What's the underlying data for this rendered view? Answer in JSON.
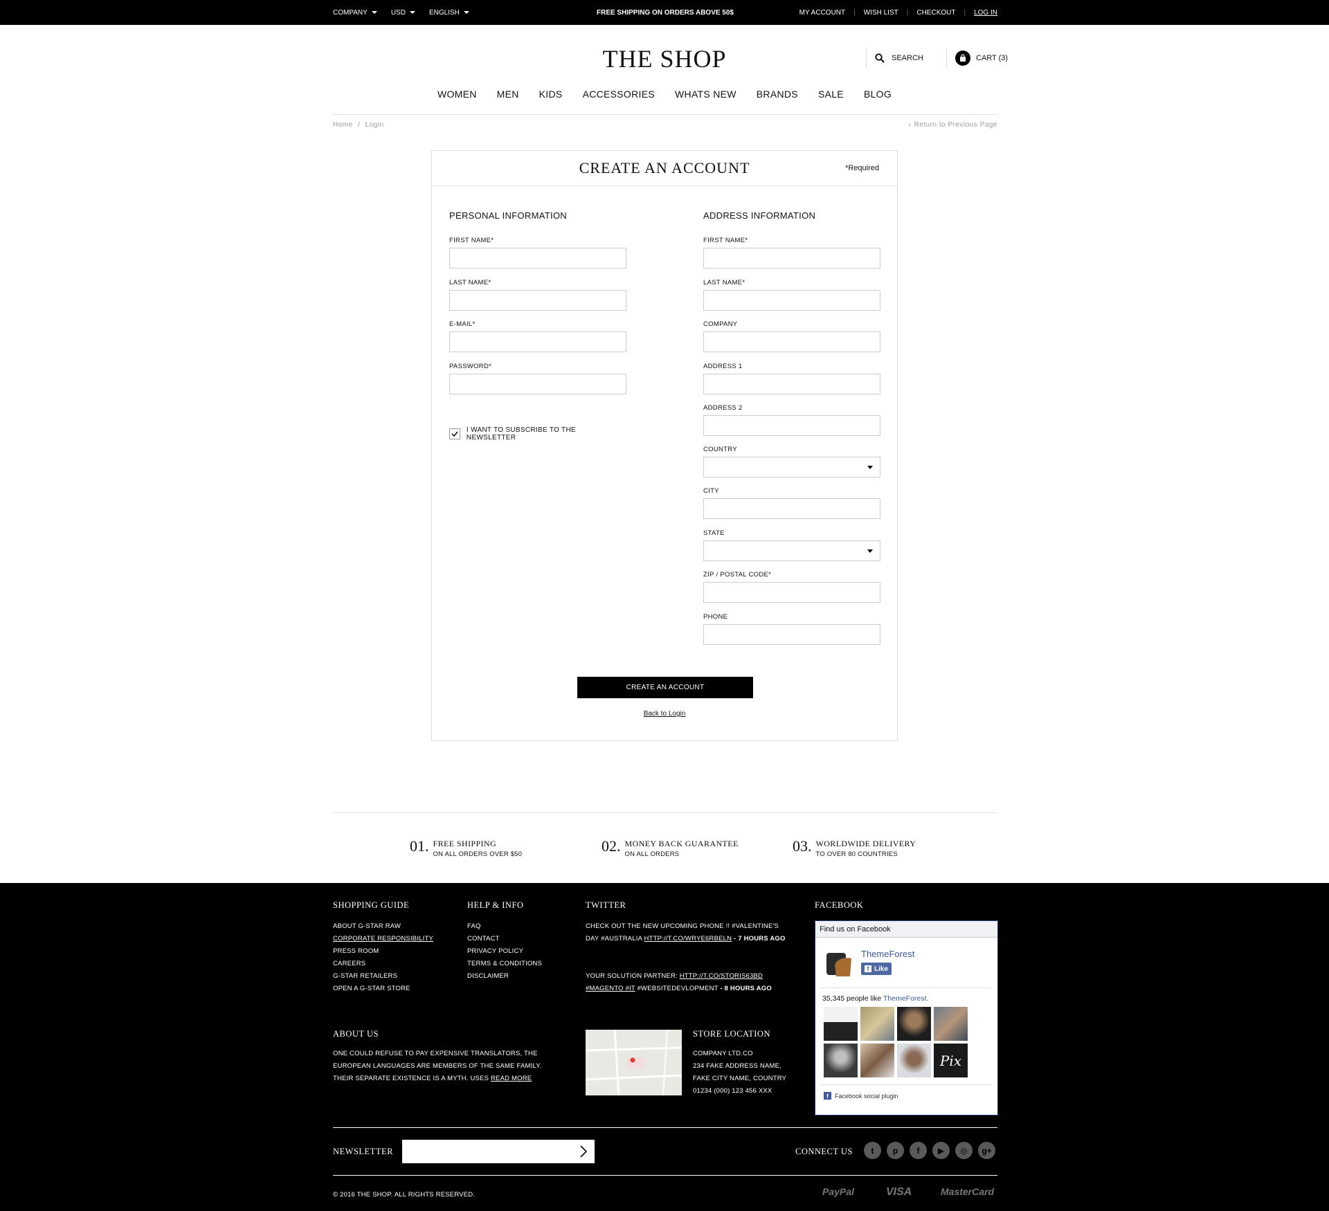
{
  "topbar": {
    "company": "COMPANY",
    "currency": "USD",
    "language": "ENGLISH",
    "promo": "FREE SHIPPING ON ORDERS ABOVE 50$",
    "my_account": "MY ACCOUNT",
    "wish_list": "WISH LIST",
    "checkout": "CHECKOUT",
    "login": "LOG IN"
  },
  "header": {
    "logo": "THE SHOP",
    "search": "SEARCH",
    "cart": "CART (3)"
  },
  "nav": [
    "WOMEN",
    "MEN",
    "KIDS",
    "ACCESSORIES",
    "WHATS NEW",
    "BRANDS",
    "SALE",
    "BLOG"
  ],
  "breadcrumb": {
    "home": "Home",
    "sep": "/",
    "current": "Login"
  },
  "return_link": "Return to Previous Page",
  "form": {
    "title": "CREATE AN ACCOUNT",
    "required_note": "*Required",
    "personal_heading": "PERSONAL INFORMATION",
    "address_heading": "ADDRESS INFORMATION",
    "personal_fields": [
      "FIRST NAME*",
      "LAST NAME*",
      "E-MAIL*",
      "PASSWORD*"
    ],
    "address_fields": [
      "FIRST NAME*",
      "LAST NAME*",
      "COMPANY",
      "ADDRESS 1",
      "ADDRESS 2",
      "COUNTRY",
      "CITY",
      "STATE",
      "ZIP / POSTAL CODE*",
      "PHONE"
    ],
    "newsletter_label": "I WANT TO SUBSCRIBE TO THE NEWSLETTER",
    "newsletter_checked": true,
    "submit": "CREATE AN ACCOUNT",
    "back": "Back to Login"
  },
  "features": [
    {
      "num": "01.",
      "title": "FREE SHIPPING",
      "sub": "ON ALL ORDERS OVER $50"
    },
    {
      "num": "02.",
      "title": "MONEY BACK GUARANTEE",
      "sub": "ON ALL ORDERS"
    },
    {
      "num": "03.",
      "title": "WORLDWIDE DELIVERY",
      "sub": "TO OVER 80 COUNTRIES"
    }
  ],
  "footer": {
    "shopping_guide": {
      "heading": "SHOPPING GUIDE",
      "items": [
        "ABOUT G-STAR RAW",
        "CORPORATE RESPONSIBILITY",
        "PRESS ROOM",
        "CAREERS",
        "G-STAR RETAILERS",
        "OPEN A G-STAR STORE"
      ]
    },
    "help": {
      "heading": "HELP & INFO",
      "items": [
        "FAQ",
        "CONTACT",
        "PRIVACY POLICY",
        "TERMS & CONDITIONS",
        "DISCLAIMER"
      ]
    },
    "twitter": {
      "heading": "TWITTER",
      "t1_text": "CHECK OUT THE NEW UPCOMING PHONE !! #VALENTINE'S DAY #AUSTRALIA",
      "t1_link": "HTTP://T.CO/WRYE6RBELN",
      "t1_time": "- 7 HOURS AGO",
      "t2_text": "YOUR SOLUTION PARTNER:",
      "t2_link": "HTTP://T.CO/STORIS63BD",
      "t2_tags": "#MAGENTO #IT",
      "t2_rest": "#WEBSITEDEVLOPMENT",
      "t2_time": "- 8 HOURS AGO"
    },
    "facebook": {
      "heading": "FACEBOOK",
      "box_title": "Find us on Facebook",
      "page_name": "ThemeForest",
      "like": "Like",
      "count_text": "35,345 people like",
      "count_page": "ThemeForest.",
      "plugin": "Facebook social plugin"
    },
    "about": {
      "heading": "ABOUT US",
      "text": "ONE COULD REFUSE TO PAY EXPENSIVE TRANSLATORS, THE EUROPEAN LANGUAGES ARE MEMBERS OF THE SAME FAMILY. THEIR SEPARATE EXISTENCE IS A MYTH. USES",
      "read_more": "READ MORE"
    },
    "store": {
      "heading": "STORE LOCATION",
      "lines": [
        "COMPANY LTD.CO",
        "234 FAKE ADDRESS NAME,",
        "FAKE CITY NAME, COUNTRY",
        "01234 (000) 123 456 XXX"
      ]
    },
    "newsletter": "NEWSLETTER",
    "connect": "CONNECT US",
    "copyright": "© 2016 THE SHOP. ALL RIGHTS RESERVED.",
    "payments": [
      "PayPal",
      "VISA",
      "MasterCard"
    ]
  }
}
